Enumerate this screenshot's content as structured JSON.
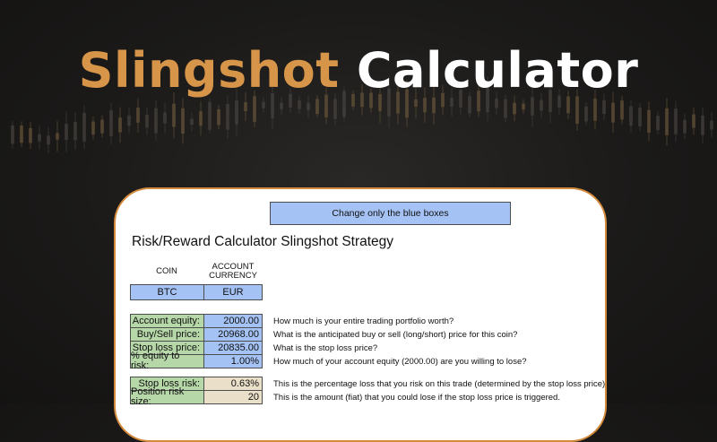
{
  "hero": {
    "word1": "Slingshot",
    "word2": "Calculator"
  },
  "colors": {
    "accent": "#d7954a",
    "card_border": "#d38a3d",
    "blue_input": "#a4c2f4",
    "green_label": "#b6d7a8",
    "tan_label": "#eadfc8"
  },
  "sheet": {
    "note": "Change only the blue boxes",
    "title": "Risk/Reward Calculator Slingshot Strategy",
    "coin_header": "COIN",
    "currency_header_line1": "ACCOUNT",
    "currency_header_line2": "CURRENCY",
    "coin": "BTC",
    "currency": "EUR",
    "inputs": [
      {
        "label": "Account equity:",
        "value": "2000.00",
        "desc": "How much is your entire trading portfolio worth?"
      },
      {
        "label": "Buy/Sell price:",
        "value": "20968.00",
        "desc": "What is the anticipated buy or sell (long/short) price for this coin?"
      },
      {
        "label": "Stop loss price:",
        "value": "20835.00",
        "desc": "What is the stop loss price?"
      },
      {
        "label": "% equity to risk:",
        "value": "1.00%",
        "desc": "How much of your account equity (2000.00) are you willing to lose?"
      }
    ],
    "outputs": [
      {
        "label": "Stop loss risk:",
        "value": "0.63%",
        "desc": "This is the percentage loss that you risk on this trade (determined by the stop loss price)"
      },
      {
        "label": "Position risk size:",
        "value": "20",
        "desc": "This is the amount (fiat) that you could lose if the stop loss price is triggered."
      }
    ]
  }
}
